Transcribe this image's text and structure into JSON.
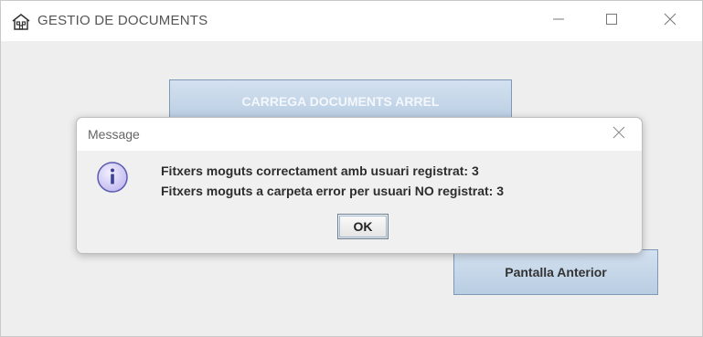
{
  "window": {
    "title": "GESTIO DE DOCUMENTS",
    "icon": "building-icon",
    "controls": [
      "minimize-icon",
      "maximize-icon",
      "close-icon"
    ]
  },
  "main": {
    "load_button_label": "CARREGA DOCUMENTS ARREL",
    "previous_button_label": "Pantalla Anterior"
  },
  "dialog": {
    "title": "Message",
    "icon": "info-icon",
    "line1": "Fitxers moguts correctament amb usuari registrat: 3",
    "line2": "Fitxers moguts a carpeta error per usuari NO registrat: 3",
    "ok_label": "OK"
  },
  "colors": {
    "button_gradient_top": "#d3e1f0",
    "button_gradient_bottom": "#b9cde2",
    "info_icon_fill": "#d9d3f7",
    "info_icon_stroke": "#5a5cae"
  }
}
